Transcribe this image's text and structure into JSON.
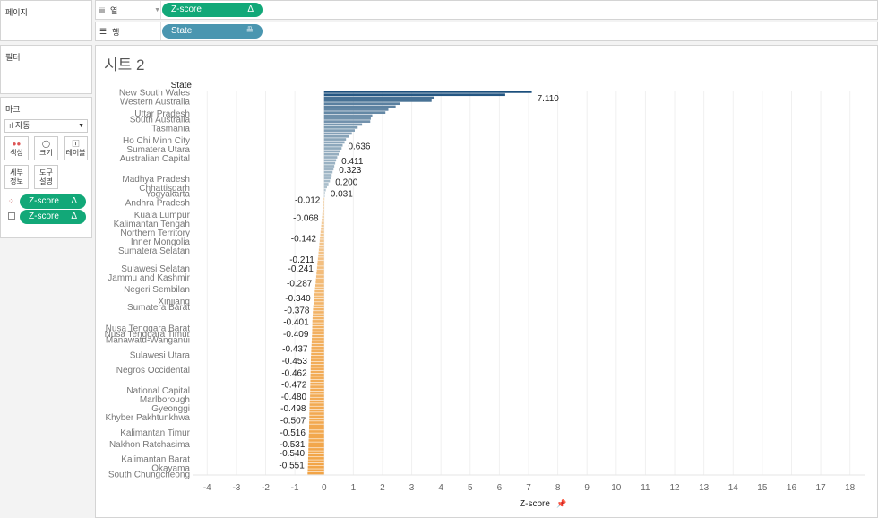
{
  "left_panel": {
    "pages_title": "페이지",
    "filters_title": "필터",
    "marks_title": "마크",
    "mark_type": "자동",
    "mark_buttons": [
      "색상",
      "크기",
      "레이블",
      "세부\n정보",
      "도구\n설명"
    ],
    "mark_pills": [
      "Z-score",
      "Z-score"
    ]
  },
  "shelves": {
    "columns_label": "열",
    "rows_label": "행",
    "columns_pill": "Z-score",
    "rows_pill": "State",
    "delta_symbol": "Δ"
  },
  "sheet": {
    "title": "시트 2"
  },
  "chart_data": {
    "type": "bar",
    "orientation": "horizontal",
    "title": "시트 2",
    "ylabel": "State",
    "xlabel": "Z-score",
    "xlim": [
      -4.5,
      18.5
    ],
    "xticks": [
      -4,
      -3,
      -2,
      -1,
      0,
      1,
      2,
      3,
      4,
      5,
      6,
      7,
      8,
      9,
      10,
      11,
      12,
      13,
      14,
      15,
      16,
      17,
      18
    ],
    "colors": {
      "pos_dark": "#1b4f7d",
      "pos_light": "#c9d6dc",
      "neg_light": "#f3d1a6",
      "neg_dark": "#f2a446"
    },
    "values": [
      7.11,
      6.2,
      3.75,
      3.68,
      2.6,
      2.45,
      2.2,
      2.1,
      1.65,
      1.6,
      1.58,
      1.3,
      1.15,
      1.05,
      0.95,
      0.85,
      0.75,
      0.7,
      0.636,
      0.6,
      0.55,
      0.5,
      0.45,
      0.411,
      0.38,
      0.35,
      0.323,
      0.29,
      0.26,
      0.23,
      0.2,
      0.15,
      0.1,
      0.06,
      0.031,
      0.01,
      -0.012,
      -0.02,
      -0.03,
      -0.04,
      -0.05,
      -0.06,
      -0.068,
      -0.08,
      -0.09,
      -0.1,
      -0.11,
      -0.12,
      -0.13,
      -0.142,
      -0.15,
      -0.16,
      -0.17,
      -0.18,
      -0.19,
      -0.2,
      -0.211,
      -0.22,
      -0.23,
      -0.241,
      -0.25,
      -0.26,
      -0.27,
      -0.28,
      -0.287,
      -0.3,
      -0.31,
      -0.32,
      -0.33,
      -0.34,
      -0.35,
      -0.36,
      -0.37,
      -0.378,
      -0.385,
      -0.39,
      -0.395,
      -0.401,
      -0.403,
      -0.405,
      -0.407,
      -0.409,
      -0.415,
      -0.42,
      -0.425,
      -0.43,
      -0.437,
      -0.44,
      -0.445,
      -0.45,
      -0.453,
      -0.455,
      -0.458,
      -0.46,
      -0.462,
      -0.465,
      -0.468,
      -0.47,
      -0.472,
      -0.474,
      -0.476,
      -0.478,
      -0.48,
      -0.485,
      -0.49,
      -0.495,
      -0.498,
      -0.5,
      -0.503,
      -0.505,
      -0.507,
      -0.51,
      -0.512,
      -0.514,
      -0.516,
      -0.52,
      -0.524,
      -0.528,
      -0.531,
      -0.534,
      -0.537,
      -0.54,
      -0.543,
      -0.546,
      -0.549,
      -0.551,
      -0.555,
      -0.56,
      -0.565
    ],
    "data_labels": [
      "7.110",
      "0.636",
      "0.411",
      "0.323",
      "0.200",
      "0.031",
      "-0.012",
      "-0.068",
      "-0.142",
      "-0.211",
      "-0.241",
      "-0.287",
      "-0.340",
      "-0.378",
      "-0.401",
      "-0.409",
      "-0.437",
      "-0.453",
      "-0.462",
      "-0.472",
      "-0.480",
      "-0.498",
      "-0.507",
      "-0.516",
      "-0.531",
      "-0.540",
      "-0.551"
    ],
    "category_labels": [
      {
        "i": 0,
        "t": "New South Wales"
      },
      {
        "i": 3,
        "t": "Western Australia"
      },
      {
        "i": 7,
        "t": "Uttar Pradesh"
      },
      {
        "i": 9,
        "t": "South Australia"
      },
      {
        "i": 12,
        "t": "Tasmania"
      },
      {
        "i": 16,
        "t": "Ho Chi Minh City"
      },
      {
        "i": 19,
        "t": "Sumatera Utara"
      },
      {
        "i": 22,
        "t": "Australian Capital"
      },
      {
        "i": 29,
        "t": "Madhya Pradesh"
      },
      {
        "i": 32,
        "t": "Chhattisgarh"
      },
      {
        "i": 34,
        "t": "Yogyakarta"
      },
      {
        "i": 37,
        "t": "Andhra Pradesh"
      },
      {
        "i": 41,
        "t": "Kuala Lumpur"
      },
      {
        "i": 44,
        "t": "Kalimantan Tengah"
      },
      {
        "i": 47,
        "t": "Northern Territory"
      },
      {
        "i": 50,
        "t": "Inner Mongolia"
      },
      {
        "i": 53,
        "t": "Sumatera Selatan"
      },
      {
        "i": 59,
        "t": "Sulawesi Selatan"
      },
      {
        "i": 62,
        "t": "Jammu and Kashmir"
      },
      {
        "i": 66,
        "t": "Negeri Sembilan"
      },
      {
        "i": 70,
        "t": "Xinjiang"
      },
      {
        "i": 72,
        "t": "Sumatera Barat"
      },
      {
        "i": 79,
        "t": "Nusa Tenggara Barat"
      },
      {
        "i": 81,
        "t": "Nusa Tenggara Timur"
      },
      {
        "i": 83,
        "t": "Manawatu-Wanganui"
      },
      {
        "i": 88,
        "t": "Sulawesi Utara"
      },
      {
        "i": 93,
        "t": "Negros Occidental"
      },
      {
        "i": 100,
        "t": "National Capital"
      },
      {
        "i": 103,
        "t": "Marlborough"
      },
      {
        "i": 106,
        "t": "Gyeonggi"
      },
      {
        "i": 109,
        "t": "Khyber Pakhtunkhwa"
      },
      {
        "i": 114,
        "t": "Kalimantan Timur"
      },
      {
        "i": 118,
        "t": "Nakhon Ratchasima"
      },
      {
        "i": 123,
        "t": "Kalimantan Barat"
      },
      {
        "i": 126,
        "t": "Okayama"
      },
      {
        "i": 128,
        "t": "South Chungcheong"
      }
    ]
  }
}
